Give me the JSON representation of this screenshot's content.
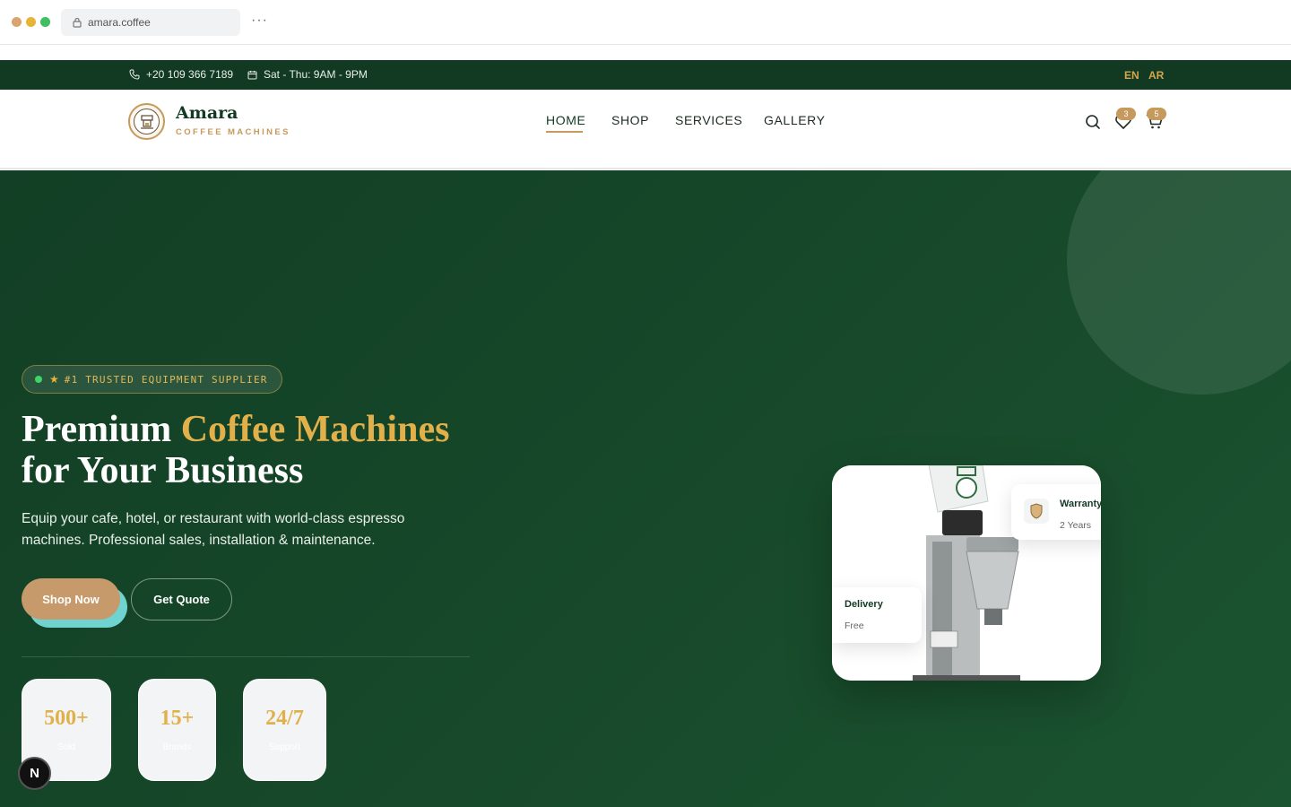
{
  "browser": {
    "url": "amara.coffee",
    "more_label": "···"
  },
  "topbar": {
    "phone": "+20 109 366 7189",
    "hours": "Sat - Thu: 9AM - 9PM",
    "languages": [
      "EN",
      "AR"
    ]
  },
  "brand": {
    "name": "Amara",
    "tagline": "COFFEE MACHINES"
  },
  "nav": {
    "items": [
      {
        "label": "HOME",
        "active": true
      },
      {
        "label": "SHOP",
        "active": false
      },
      {
        "label": "SERVICES",
        "active": false
      },
      {
        "label": "GALLERY",
        "active": false
      }
    ],
    "wishlist_count": "3",
    "cart_count": "5",
    "icons": [
      "search-icon",
      "heart-icon",
      "cart-icon"
    ]
  },
  "hero": {
    "badge": "#1 TRUSTED EQUIPMENT SUPPLIER",
    "headline_part1": "Premium ",
    "headline_accent": "Coffee Machines",
    "headline_part2": "for Your Business",
    "description": "Equip your cafe, hotel, or restaurant with world-class espresso machines. Professional sales, installation & maintenance.",
    "primary_button": "Shop Now",
    "secondary_button": "Get Quote",
    "stats": [
      {
        "value": "500+",
        "label": "Sold"
      },
      {
        "value": "15+",
        "label": "Brands"
      },
      {
        "value": "24/7",
        "label": "Support"
      }
    ]
  },
  "product_card": {
    "warranty_title": "Warranty",
    "warranty_value": "2 Years",
    "delivery_title": "Delivery",
    "delivery_value": "Free"
  },
  "dev_badge": "N",
  "colors": {
    "primary_green": "#123a23",
    "accent_gold": "#e2b04a",
    "button_tan": "#c69a6a",
    "button_shadow_teal": "#6fd3cf"
  }
}
